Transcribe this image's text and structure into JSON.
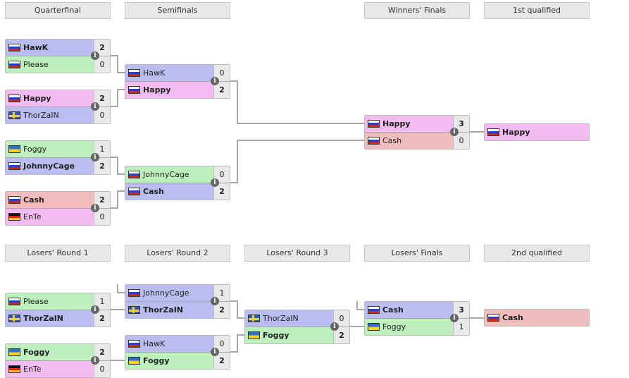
{
  "colors": {
    "blue": "#bbbdf0",
    "green": "#bcf0bc",
    "pink": "#f2bcf2",
    "red": "#f0bcbc"
  },
  "headers": [
    {
      "label": "Quarterfinal",
      "col": 0,
      "sec": "u"
    },
    {
      "label": "Semifinals",
      "col": 1,
      "sec": "u"
    },
    {
      "label": "Winners' Finals",
      "col": 3,
      "sec": "u"
    },
    {
      "label": "1st qualified",
      "col": 4,
      "sec": "u"
    },
    {
      "label": "Losers' Round 1",
      "col": 0,
      "sec": "l"
    },
    {
      "label": "Losers' Round 2",
      "col": 1,
      "sec": "l"
    },
    {
      "label": "Losers' Round 3",
      "col": 2,
      "sec": "l"
    },
    {
      "label": "Losers' Finals",
      "col": 3,
      "sec": "l"
    },
    {
      "label": "2nd qualified",
      "col": 4,
      "sec": "l"
    }
  ],
  "matches": [
    {
      "round": "Quarterfinal",
      "players": [
        {
          "name": "HawK",
          "flag": "ru",
          "score": "2",
          "color": "blue",
          "win": true
        },
        {
          "name": "Please",
          "flag": "ru",
          "score": "0",
          "color": "green"
        }
      ]
    },
    {
      "round": "Quarterfinal",
      "players": [
        {
          "name": "Happy",
          "flag": "ru",
          "score": "2",
          "color": "pink",
          "win": true
        },
        {
          "name": "ThorZaIN",
          "flag": "se",
          "score": "0",
          "color": "blue"
        }
      ]
    },
    {
      "round": "Quarterfinal",
      "players": [
        {
          "name": "Foggy",
          "flag": "ua",
          "score": "1",
          "color": "green"
        },
        {
          "name": "JohnnyCage",
          "flag": "ru",
          "score": "2",
          "color": "blue",
          "win": true
        }
      ]
    },
    {
      "round": "Quarterfinal",
      "players": [
        {
          "name": "Cash",
          "flag": "ru",
          "score": "2",
          "color": "red",
          "win": true
        },
        {
          "name": "EnTe",
          "flag": "de",
          "score": "0",
          "color": "pink"
        }
      ]
    },
    {
      "round": "Semifinals",
      "players": [
        {
          "name": "HawK",
          "flag": "ru",
          "score": "0",
          "color": "blue"
        },
        {
          "name": "Happy",
          "flag": "ru",
          "score": "2",
          "color": "pink",
          "win": true
        }
      ]
    },
    {
      "round": "Semifinals",
      "players": [
        {
          "name": "JohnnyCage",
          "flag": "ru",
          "score": "0",
          "color": "green"
        },
        {
          "name": "Cash",
          "flag": "ru",
          "score": "2",
          "color": "blue",
          "win": true
        }
      ]
    },
    {
      "round": "Winners' Finals",
      "players": [
        {
          "name": "Happy",
          "flag": "ru",
          "score": "3",
          "color": "pink",
          "win": true
        },
        {
          "name": "Cash",
          "flag": "ru",
          "score": "0",
          "color": "red"
        }
      ]
    },
    {
      "round": "1st qualified",
      "players": [
        {
          "name": "Happy",
          "flag": "ru",
          "color": "pink",
          "win": true
        }
      ]
    },
    {
      "round": "Losers' Round 1",
      "players": [
        {
          "name": "Please",
          "flag": "ru",
          "score": "1",
          "color": "green"
        },
        {
          "name": "ThorZaIN",
          "flag": "se",
          "score": "2",
          "color": "blue",
          "win": true
        }
      ]
    },
    {
      "round": "Losers' Round 1",
      "players": [
        {
          "name": "Foggy",
          "flag": "ua",
          "score": "2",
          "color": "green",
          "win": true
        },
        {
          "name": "EnTe",
          "flag": "de",
          "score": "0",
          "color": "pink"
        }
      ]
    },
    {
      "round": "Losers' Round 2",
      "players": [
        {
          "name": "JohnnyCage",
          "flag": "ru",
          "score": "1",
          "color": "blue"
        },
        {
          "name": "ThorZaIN",
          "flag": "se",
          "score": "2",
          "color": "blue",
          "win": true
        }
      ]
    },
    {
      "round": "Losers' Round 2",
      "players": [
        {
          "name": "HawK",
          "flag": "ru",
          "score": "0",
          "color": "blue"
        },
        {
          "name": "Foggy",
          "flag": "ua",
          "score": "2",
          "color": "green",
          "win": true
        }
      ]
    },
    {
      "round": "Losers' Round 3",
      "players": [
        {
          "name": "ThorZaIN",
          "flag": "se",
          "score": "0",
          "color": "blue"
        },
        {
          "name": "Foggy",
          "flag": "ua",
          "score": "2",
          "color": "green",
          "win": true
        }
      ]
    },
    {
      "round": "Losers' Finals",
      "players": [
        {
          "name": "Cash",
          "flag": "ru",
          "score": "3",
          "color": "blue",
          "win": true
        },
        {
          "name": "Foggy",
          "flag": "ua",
          "score": "1",
          "color": "green"
        }
      ]
    },
    {
      "round": "2nd qualified",
      "players": [
        {
          "name": "Cash",
          "flag": "ru",
          "color": "red",
          "win": true
        }
      ]
    }
  ]
}
